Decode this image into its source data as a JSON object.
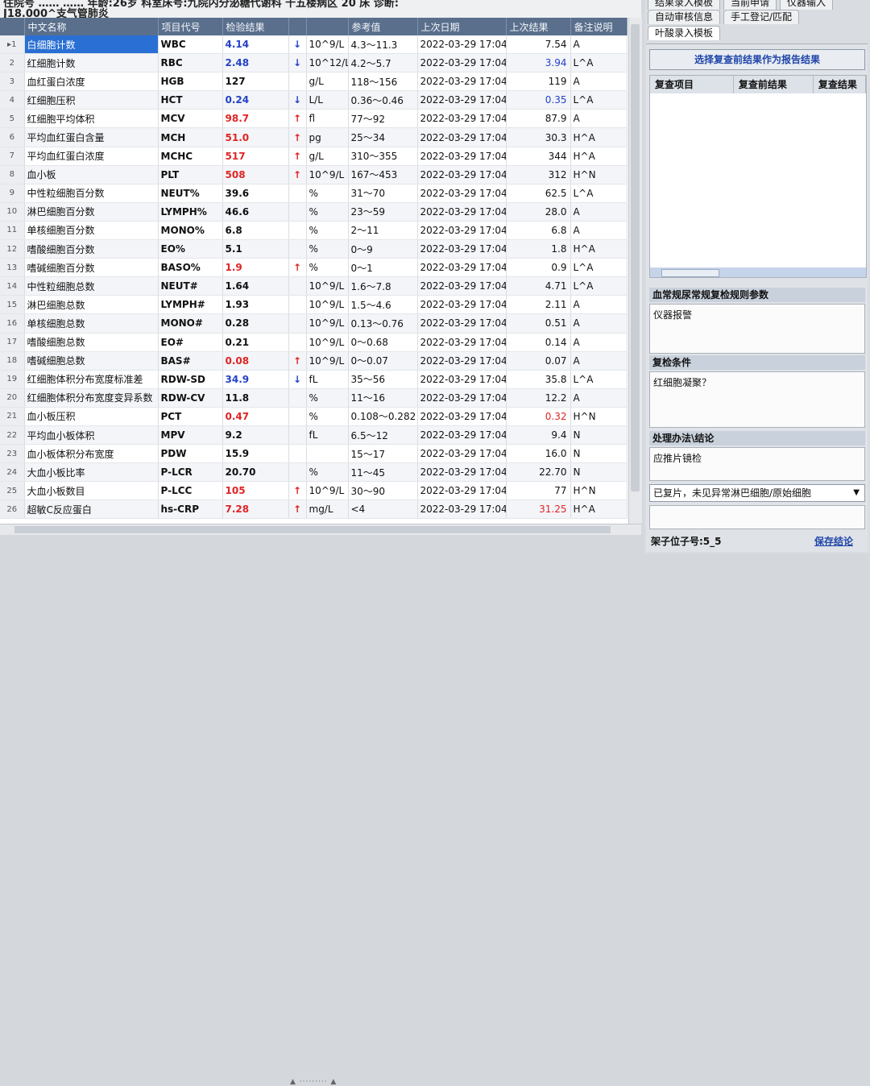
{
  "header": {
    "line1": "住院号 ……  ……  年龄:26岁  科室床号:九院内分泌糖代谢科 十五楼病区 20 床  诊断:",
    "line2": "J18.000^支气管肺炎"
  },
  "columns": [
    "",
    "中文名称",
    "项目代号",
    "检验结果",
    "",
    "",
    "参考值",
    "上次日期",
    "上次结果",
    "备注说明"
  ],
  "rows": [
    {
      "num": "1",
      "name": "白细胞计数",
      "code": "WBC",
      "result": "4.14",
      "flag": "↓",
      "unit": "10^9/L",
      "ref": "4.3～11.3",
      "date": "2022-03-29 17:04",
      "prev": "7.54",
      "note": "A"
    },
    {
      "num": "2",
      "name": "红细胞计数",
      "code": "RBC",
      "result": "2.48",
      "flag": "↓",
      "unit": "10^12/L",
      "ref": "4.2～5.7",
      "date": "2022-03-29 17:04",
      "prev": "3.94",
      "note": "L^A"
    },
    {
      "num": "3",
      "name": "血红蛋白浓度",
      "code": "HGB",
      "result": "127",
      "flag": "",
      "unit": "g/L",
      "ref": "118～156",
      "date": "2022-03-29 17:04",
      "prev": "119",
      "note": "A"
    },
    {
      "num": "4",
      "name": "红细胞压积",
      "code": "HCT",
      "result": "0.24",
      "flag": "↓",
      "unit": "L/L",
      "ref": "0.36～0.46",
      "date": "2022-03-29 17:04",
      "prev": "0.35",
      "note": "L^A"
    },
    {
      "num": "5",
      "name": "红细胞平均体积",
      "code": "MCV",
      "result": "98.7",
      "flag": "↑",
      "unit": "fl",
      "ref": "77～92",
      "date": "2022-03-29 17:04",
      "prev": "87.9",
      "note": "A"
    },
    {
      "num": "6",
      "name": "平均血红蛋白含量",
      "code": "MCH",
      "result": "51.0",
      "flag": "↑",
      "unit": "pg",
      "ref": "25～34",
      "date": "2022-03-29 17:04",
      "prev": "30.3",
      "note": "H^A"
    },
    {
      "num": "7",
      "name": "平均血红蛋白浓度",
      "code": "MCHC",
      "result": "517",
      "flag": "↑",
      "unit": "g/L",
      "ref": "310～355",
      "date": "2022-03-29 17:04",
      "prev": "344",
      "note": "H^A"
    },
    {
      "num": "8",
      "name": "血小板",
      "code": "PLT",
      "result": "508",
      "flag": "↑",
      "unit": "10^9/L",
      "ref": "167～453",
      "date": "2022-03-29 17:04",
      "prev": "312",
      "note": "H^N"
    },
    {
      "num": "9",
      "name": "中性粒细胞百分数",
      "code": "NEUT%",
      "result": "39.6",
      "flag": "",
      "unit": "%",
      "ref": "31～70",
      "date": "2022-03-29 17:04",
      "prev": "62.5",
      "note": "L^A"
    },
    {
      "num": "10",
      "name": "淋巴细胞百分数",
      "code": "LYMPH%",
      "result": "46.6",
      "flag": "",
      "unit": "%",
      "ref": "23～59",
      "date": "2022-03-29 17:04",
      "prev": "28.0",
      "note": "A"
    },
    {
      "num": "11",
      "name": "单核细胞百分数",
      "code": "MONO%",
      "result": "6.8",
      "flag": "",
      "unit": "%",
      "ref": "2～11",
      "date": "2022-03-29 17:04",
      "prev": "6.8",
      "note": "A"
    },
    {
      "num": "12",
      "name": "嗜酸细胞百分数",
      "code": "EO%",
      "result": "5.1",
      "flag": "",
      "unit": "%",
      "ref": "0～9",
      "date": "2022-03-29 17:04",
      "prev": "1.8",
      "note": "H^A"
    },
    {
      "num": "13",
      "name": "嗜碱细胞百分数",
      "code": "BASO%",
      "result": "1.9",
      "flag": "↑",
      "unit": "%",
      "ref": "0～1",
      "date": "2022-03-29 17:04",
      "prev": "0.9",
      "note": "L^A"
    },
    {
      "num": "14",
      "name": "中性粒细胞总数",
      "code": "NEUT#",
      "result": "1.64",
      "flag": "",
      "unit": "10^9/L",
      "ref": "1.6～7.8",
      "date": "2022-03-29 17:04",
      "prev": "4.71",
      "note": "L^A"
    },
    {
      "num": "15",
      "name": "淋巴细胞总数",
      "code": "LYMPH#",
      "result": "1.93",
      "flag": "",
      "unit": "10^9/L",
      "ref": "1.5～4.6",
      "date": "2022-03-29 17:04",
      "prev": "2.11",
      "note": "A"
    },
    {
      "num": "16",
      "name": "单核细胞总数",
      "code": "MONO#",
      "result": "0.28",
      "flag": "",
      "unit": "10^9/L",
      "ref": "0.13～0.76",
      "date": "2022-03-29 17:04",
      "prev": "0.51",
      "note": "A"
    },
    {
      "num": "17",
      "name": "嗜酸细胞总数",
      "code": "EO#",
      "result": "0.21",
      "flag": "",
      "unit": "10^9/L",
      "ref": "0～0.68",
      "date": "2022-03-29 17:04",
      "prev": "0.14",
      "note": "A"
    },
    {
      "num": "18",
      "name": "嗜碱细胞总数",
      "code": "BAS#",
      "result": "0.08",
      "flag": "↑",
      "unit": "10^9/L",
      "ref": "0～0.07",
      "date": "2022-03-29 17:04",
      "prev": "0.07",
      "note": "A"
    },
    {
      "num": "19",
      "name": "红细胞体积分布宽度标准差",
      "code": "RDW-SD",
      "result": "34.9",
      "flag": "↓",
      "unit": "fL",
      "ref": "35～56",
      "date": "2022-03-29 17:04",
      "prev": "35.8",
      "note": "L^A"
    },
    {
      "num": "20",
      "name": "红细胞体积分布宽度变异系数",
      "code": "RDW-CV",
      "result": "11.8",
      "flag": "",
      "unit": "%",
      "ref": "11～16",
      "date": "2022-03-29 17:04",
      "prev": "12.2",
      "note": "A"
    },
    {
      "num": "21",
      "name": "血小板压积",
      "code": "PCT",
      "result": "0.47",
      "flag": "",
      "unit": "%",
      "ref": "0.108～0.282",
      "date": "2022-03-29 17:04",
      "prev": "0.32",
      "note": "H^N"
    },
    {
      "num": "22",
      "name": "平均血小板体积",
      "code": "MPV",
      "result": "9.2",
      "flag": "",
      "unit": "fL",
      "ref": "6.5～12",
      "date": "2022-03-29 17:04",
      "prev": "9.4",
      "note": "N"
    },
    {
      "num": "23",
      "name": "血小板体积分布宽度",
      "code": "PDW",
      "result": "15.9",
      "flag": "",
      "unit": "",
      "ref": "15～17",
      "date": "2022-03-29 17:04",
      "prev": "16.0",
      "note": "N"
    },
    {
      "num": "24",
      "name": "大血小板比率",
      "code": "P-LCR",
      "result": "20.70",
      "flag": "",
      "unit": "%",
      "ref": "11～45",
      "date": "2022-03-29 17:04",
      "prev": "22.70",
      "note": "N"
    },
    {
      "num": "25",
      "name": "大血小板数目",
      "code": "P-LCC",
      "result": "105",
      "flag": "↑",
      "unit": "10^9/L",
      "ref": "30～90",
      "date": "2022-03-29 17:04",
      "prev": "77",
      "note": "H^N"
    },
    {
      "num": "26",
      "name": "超敏C反应蛋白",
      "code": "hs-CRP",
      "result": "7.28",
      "flag": "↑",
      "unit": "mg/L",
      "ref": "<4",
      "date": "2022-03-29 17:04",
      "prev": "31.25",
      "note": "H^A"
    }
  ],
  "result_colors": {
    "1": "blue",
    "2": "blue",
    "4": "blue",
    "5": "red",
    "6": "red",
    "7": "red",
    "8": "red",
    "13": "red",
    "18": "red",
    "19": "blue",
    "21": "red",
    "25": "red",
    "26": "red"
  },
  "prev_colors": {
    "2": "blue",
    "4": "blue",
    "21": "red",
    "26": "red"
  },
  "selected_row": "1",
  "right_panel": {
    "tabs_row1": [
      "结果录入模板",
      "当前申请",
      "仪器输入"
    ],
    "tabs_row2": [
      "自动审核信息",
      "手工登记/匹配"
    ],
    "tabs_row3": [
      "叶酸录入模板"
    ],
    "choose_button": "选择复查前结果作为报告结果",
    "recheck_columns": [
      "复查项目",
      "复查前结果",
      "复查结果"
    ],
    "rules_title": "血常规尿常规复检规则参数",
    "instrument_alarm": "仪器报警",
    "recheck_condition_title": "复检条件",
    "recheck_condition_value": "红细胞凝聚？",
    "handling_title": "处理办法\\结论",
    "handling_value": "应推片镜检",
    "conclusion_selected": "已复片，未见异常淋巴细胞/原始细胞",
    "rack_label": "架子位子号:5_5",
    "save_link": "保存结论"
  },
  "colors": {
    "grid_header": "#5a6f8c",
    "selected": "#2a6fd3",
    "high": "#e02424",
    "low": "#2441c8",
    "link": "#1f45a8"
  }
}
